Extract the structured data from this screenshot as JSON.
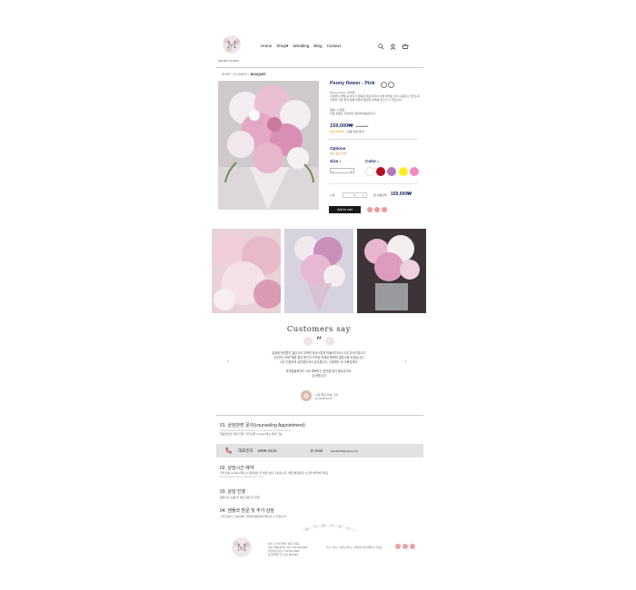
{
  "header": {
    "logo_text": "PROJECT M SHOP",
    "nav": [
      "Home",
      "Shop",
      "Wedding",
      "Blog",
      "Contact"
    ],
    "icons": [
      "search-icon",
      "user-icon",
      "cart-icon"
    ]
  },
  "breadcrumb": {
    "items": [
      "SHOP",
      "FLOWER",
      "BOUQUET"
    ]
  },
  "product": {
    "title": "Peony flower - Pink",
    "subtitle": "Peony Flower 작약꽃",
    "description1": "작약꽃의 꽃말 중 하나가 행복한 결혼이라서 신부 부케로 많이 사용되고 있습니다",
    "description2": "작약은 다른 꽃과 함께 어울려 풍성한 부케를 연출할 수 있습니다.",
    "section_label": "발송 / 수령일",
    "section_text": "주문 상품은 지정하신 날짜에 배송됩니다.",
    "price": "159,000₩",
    "old_price": "180,000₩",
    "rating_stars": "★★★★★",
    "rating_text": "(상품 리뷰 평가)",
    "options_label": "Options",
    "options_note": "필수 옵션 선택",
    "size_label": "Size",
    "size_value": "1",
    "color_label": "Color",
    "colors": [
      "#ffffff",
      "#b40f1e",
      "#b678b6",
      "#ffee22",
      "#f28cc0"
    ],
    "qty_label": "수량",
    "qty_value": "1",
    "total_label": "총 상품금액",
    "total_value": "159,000₩",
    "cart_button": "Add to cart"
  },
  "customers": {
    "title": "Customers say",
    "lines": [
      "일생에 한번뿐인 결혼식의 부케를 정성스럽게 만들어주셔서 너무 감사드립니다.",
      "사진보다 훨씬 예쁜 꽃과 향기가 가득한 부케로 행복한 결혼식을 보냈습니다.",
      "너무 친절하게 상담해주셔서 감사합니다. 다음에도 꼭 이용할게요.",
      "",
      "하객분들께서도 너무 예쁘다는 칭찬을 많이 해주셨어요.",
      "감사합니다!"
    ],
    "reviewer_name": "수원 꽃집 이용 고객",
    "review_date": "by 2018.10.07"
  },
  "info": [
    {
      "title": "01. 상담관련 문의(counseling Appointment)",
      "sub": "To create your first appointment or you need an assistant via at",
      "text": "대표번호로 상담 전화, 카카오톡 contact 메뉴 문의 가능"
    },
    {
      "title": "02. 상담시간 예약",
      "sub": "All customers ask by appointment only",
      "text": "카카오톡 contact 메뉴 & 전화상담 후 방문 상담 가능합니다. 방문 예정일과 시간을 예약해주세요"
    },
    {
      "title": "03. 상담 진행",
      "sub": "",
      "text": "원하시는 상품 및 예산 설정 후 진행"
    },
    {
      "title": "04. 샘플과 방문 및 추가 상담",
      "sub": "",
      "text": "고객 요청시 가능하며, 자세히 방문하여 확인할 수 있습니다."
    }
  ],
  "phone": {
    "label": "대표번호",
    "number": "1588-2121",
    "email_label": "E-mail",
    "email": "abcd1234@naver.com"
  },
  "footer": {
    "lines": [
      "상호:프로젝트엠샵 | 대표:홍길동",
      "TEL: 1588-2121 | FAX: 031-000-0000",
      "사업자등록번호: 123-45-67890",
      "통신판매업 신고번호 제2018호"
    ],
    "addr": "주소: 경기도 수원시 팔달구 | 개인정보관리책임자: 홍길동"
  }
}
